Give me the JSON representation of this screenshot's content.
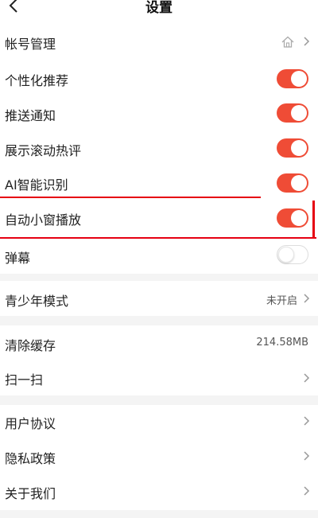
{
  "header": {
    "title": "设置"
  },
  "icons": {
    "back": "chevron-left-icon",
    "home": "home-icon",
    "chevron": "chevron-right-icon"
  },
  "colors": {
    "accent": "#ef4c36",
    "highlight": "#e60012",
    "section_gap": "#f4f4f4"
  },
  "settings": [
    {
      "label": "帐号管理"
    },
    {
      "label": "个性化推荐",
      "toggle": true
    },
    {
      "label": "推送通知",
      "toggle": true
    },
    {
      "label": "展示滚动热评",
      "toggle": true
    },
    {
      "label": "AI智能识别",
      "toggle": true
    },
    {
      "label": "自动小窗播放",
      "toggle": true
    },
    {
      "label": "弹幕",
      "toggle": false
    }
  ],
  "youth": {
    "label": "青少年模式",
    "value": "未开启"
  },
  "cache": {
    "label": "清除缓存",
    "value": "214.58MB"
  },
  "scan": {
    "label": "扫一扫"
  },
  "about": [
    {
      "label": "用户协议"
    },
    {
      "label": "隐私政策"
    },
    {
      "label": "关于我们"
    }
  ]
}
